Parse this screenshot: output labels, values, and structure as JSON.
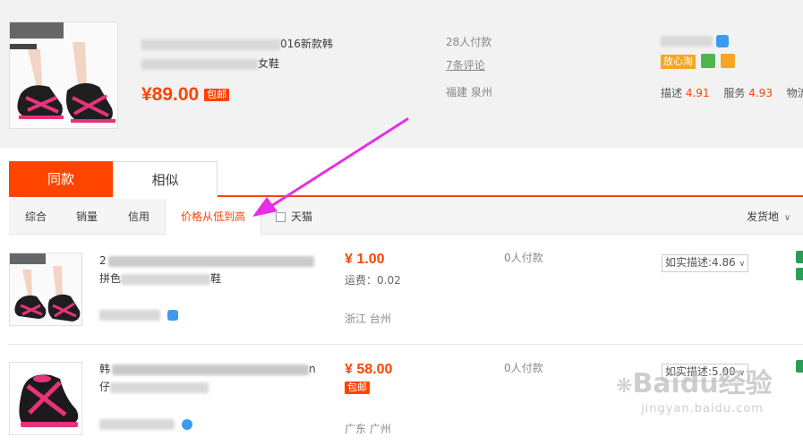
{
  "top_product": {
    "title_line1_tail": "016新款韩",
    "title_line2_tail": "女鞋",
    "price": "¥89.00",
    "free_ship_badge": "包邮",
    "paid_count": "28人付款",
    "reviews_link": "7条评论",
    "location": "福建 泉州",
    "seller_badge": "放心淘",
    "scores": [
      {
        "label": "描述",
        "value": "4.91"
      },
      {
        "label": "服务",
        "value": "4.93"
      },
      {
        "label": "物流",
        "value": ""
      }
    ]
  },
  "tabs": [
    {
      "label": "同款",
      "active": true
    },
    {
      "label": "相似",
      "active": false
    }
  ],
  "sort_bar": {
    "options": [
      "综合",
      "销量",
      "信用",
      "价格从低到高"
    ],
    "selected": "价格从低到高",
    "tmall_label": "天猫",
    "ship_from": "发货地",
    "ship_from_arrow": "∨"
  },
  "items": [
    {
      "title_line1_head": "2",
      "title_line2_head": "拼色",
      "title_line2_tail": "鞋",
      "price": "¥ 1.00",
      "shipping": "运费：0.02",
      "location": "浙江 台州",
      "paid_count": "0人付款",
      "desc_rating": "如实描述:4.86",
      "desc_arrow": "∨"
    },
    {
      "title_line1_head": "韩",
      "title_line1_tail": "n",
      "title_line2_head": "仔",
      "price": "¥ 58.00",
      "free_ship_badge": "包邮",
      "location": "广东 广州",
      "paid_count": "0人付款",
      "desc_rating": "如实描述:5.00",
      "desc_arrow": "∨"
    }
  ],
  "watermark": {
    "brand": "Baidu经验",
    "url": "jingyan.baidu.com"
  },
  "colors": {
    "accent": "#ff4400",
    "annotation_arrow": "#e62ee6",
    "seller_badge": "#f5a623"
  }
}
